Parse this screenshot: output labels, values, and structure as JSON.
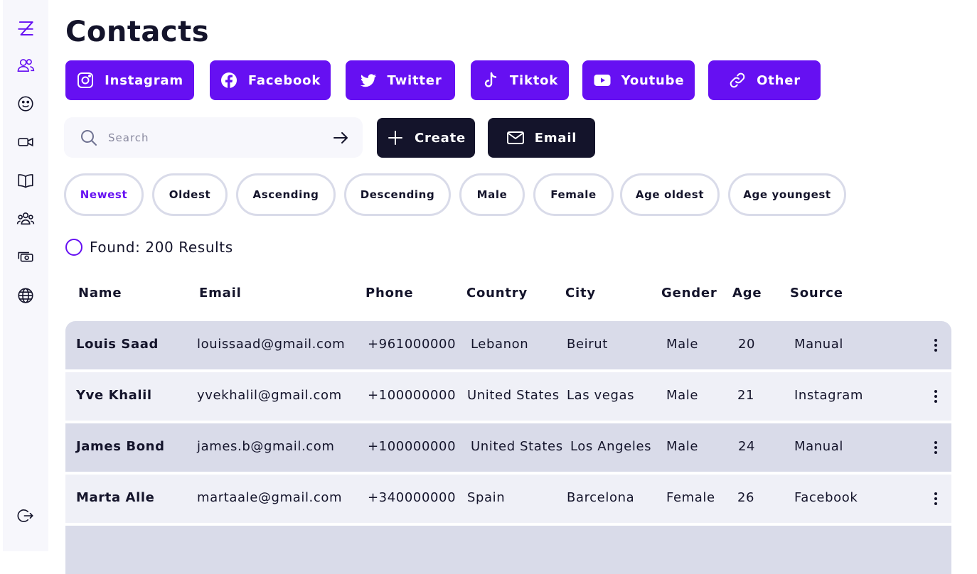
{
  "page": {
    "title": "Contacts"
  },
  "sidebar": {
    "icons": [
      "logo-icon",
      "contacts-icon",
      "smiley-icon",
      "video-icon",
      "book-icon",
      "group-icon",
      "money-icon",
      "globe-icon",
      "logout-icon"
    ]
  },
  "social": [
    {
      "label": "Instagram",
      "icon": "instagram-icon"
    },
    {
      "label": "Facebook",
      "icon": "facebook-icon"
    },
    {
      "label": "Twitter",
      "icon": "twitter-icon"
    },
    {
      "label": "Tiktok",
      "icon": "tiktok-icon"
    },
    {
      "label": "Youtube",
      "icon": "youtube-icon"
    },
    {
      "label": "Other",
      "icon": "link-icon"
    }
  ],
  "search": {
    "placeholder": "Search",
    "value": ""
  },
  "actions": {
    "create_label": "Create",
    "email_label": "Email"
  },
  "filters": [
    "Newest",
    "Oldest",
    "Ascending",
    "Descending",
    "Male",
    "Female",
    "Age oldest",
    "Age youngest"
  ],
  "found_text": "Found: 200 Results",
  "table": {
    "columns": [
      "Name",
      "Email",
      "Phone",
      "Country",
      "City",
      "Gender",
      "Age",
      "Source"
    ],
    "rows": [
      [
        "Louis Saad",
        "louissaad@gmail.com",
        "+961000000",
        "Lebanon",
        "Beirut",
        "Male",
        "20",
        "Manual"
      ],
      [
        "Yve Khalil",
        "yvekhalil@gmail.com",
        "+100000000",
        "United States",
        "Las vegas",
        "Male",
        "21",
        "Instagram"
      ],
      [
        "James Bond",
        "james.b@gmail.com",
        "+100000000",
        "United States",
        "Los Angeles",
        "Male",
        "24",
        "Manual"
      ],
      [
        "Marta Alle",
        "martaale@gmail.com",
        "+340000000",
        "Spain",
        "Barcelona",
        "Female",
        "26",
        "Facebook"
      ]
    ]
  },
  "colors": {
    "accent": "#6610f2",
    "dark": "#14142b",
    "row_dark": "#d9dbe9",
    "row_light": "#eff0f7",
    "sidebar_bg": "#f7f7fc"
  }
}
